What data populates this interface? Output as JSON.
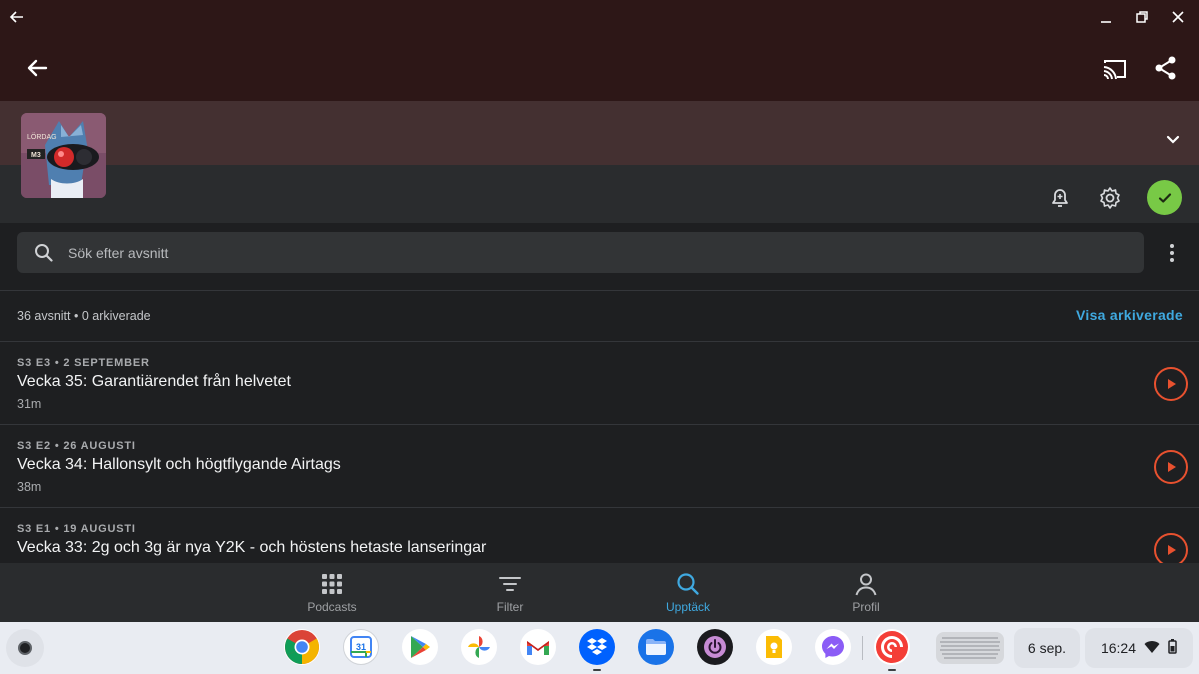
{
  "window": {
    "back_icon": "arrow-left-icon",
    "minimize_icon": "minimize-icon",
    "restore_icon": "restore-icon",
    "close_icon": "close-icon"
  },
  "header": {
    "back_icon": "arrow-left-icon",
    "cast_icon": "cast-icon",
    "share_icon": "share-icon",
    "background_color": "#2d1717"
  },
  "podcast": {
    "artwork_text_line1": "LÖRDAG",
    "artwork_text_line2": "M3",
    "band_color": "#443031",
    "subscribed_color": "#78c946"
  },
  "search": {
    "placeholder": "Sök efter avsnitt"
  },
  "stats": {
    "count_text": "36 avsnitt • 0 arkiverade",
    "show_archived": "Visa arkiverade"
  },
  "episodes": [
    {
      "meta": "S3 E3 • 2 SEPTEMBER",
      "title": "Vecka 35: Garantiärendet från helvetet",
      "duration": "31m"
    },
    {
      "meta": "S3 E2 • 26 AUGUSTI",
      "title": "Vecka 34: Hallonsylt och högtflygande Airtags",
      "duration": "38m"
    },
    {
      "meta": "S3 E1 • 19 AUGUSTI",
      "title": "Vecka 33: 2g och 3g är nya Y2K - och höstens hetaste lanseringar",
      "duration": ""
    }
  ],
  "nav": {
    "podcasts": "Podcasts",
    "filter": "Filter",
    "discover": "Upptäck",
    "profile": "Profil",
    "active_color": "#3fa9e0"
  },
  "shelf": {
    "apps": [
      "chrome-icon",
      "calendar-icon",
      "play-store-icon",
      "photos-icon",
      "gmail-icon",
      "dropbox-icon",
      "files-icon",
      "power-app-icon",
      "keep-icon",
      "messenger-icon",
      "pocket-casts-icon"
    ],
    "calendar_day": "31",
    "date": "6 sep.",
    "time": "16:24"
  },
  "accent_color": "#e8512f"
}
